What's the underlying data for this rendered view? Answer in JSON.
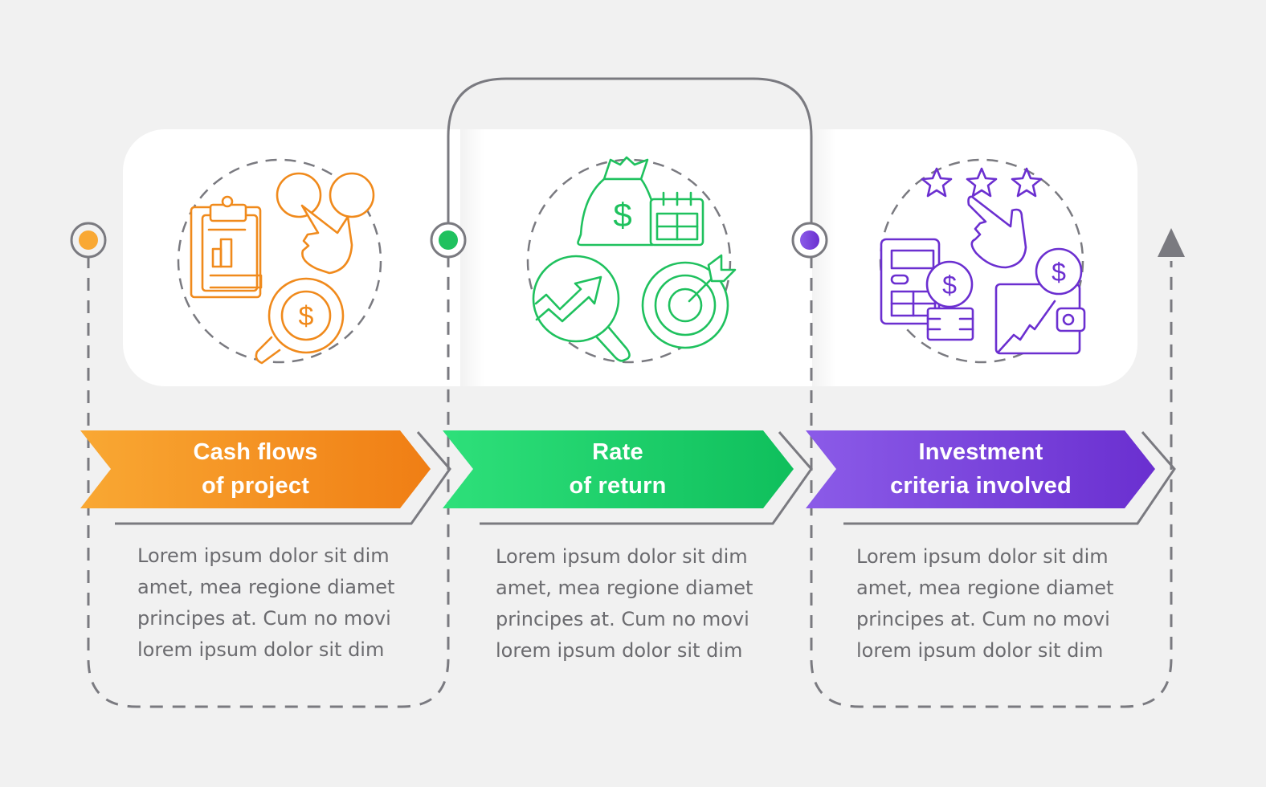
{
  "colors": {
    "background": "#f1f1f1",
    "connector": "#7a7a80",
    "step1": {
      "from": "#f9a833",
      "to": "#f07e14",
      "icon": "#f08a1c"
    },
    "step2": {
      "from": "#2ee07a",
      "to": "#0fbf5c",
      "icon": "#1fc15e"
    },
    "step3": {
      "from": "#8b5be8",
      "to": "#6a2fd0",
      "icon": "#6b2fd0"
    }
  },
  "steps": [
    {
      "title": "Cash flows\nof project",
      "description": "Lorem ipsum dolor sit dim\namet, mea regione diamet\nprincipes at. Cum no movi\nlorem ipsum dolor sit dim",
      "icons": [
        "clipboard-chart-icon",
        "hand-pointer-circles-icon",
        "magnifier-dollar-icon"
      ]
    },
    {
      "title": "Rate\nof return",
      "description": "Lorem ipsum dolor sit dim\namet, mea regione diamet\nprincipes at. Cum no movi\nlorem ipsum dolor sit dim",
      "icons": [
        "money-bag-icon",
        "calendar-icon",
        "magnifier-growth-icon",
        "target-arrow-icon"
      ]
    },
    {
      "title": "Investment\ncriteria involved",
      "description": "Lorem ipsum dolor sit dim\namet, mea regione diamet\nprincipes at. Cum no movi\nlorem ipsum dolor sit dim",
      "icons": [
        "rating-stars-icon",
        "hand-pointer-icon",
        "calculator-coins-icon",
        "wallet-growth-icon"
      ]
    }
  ]
}
